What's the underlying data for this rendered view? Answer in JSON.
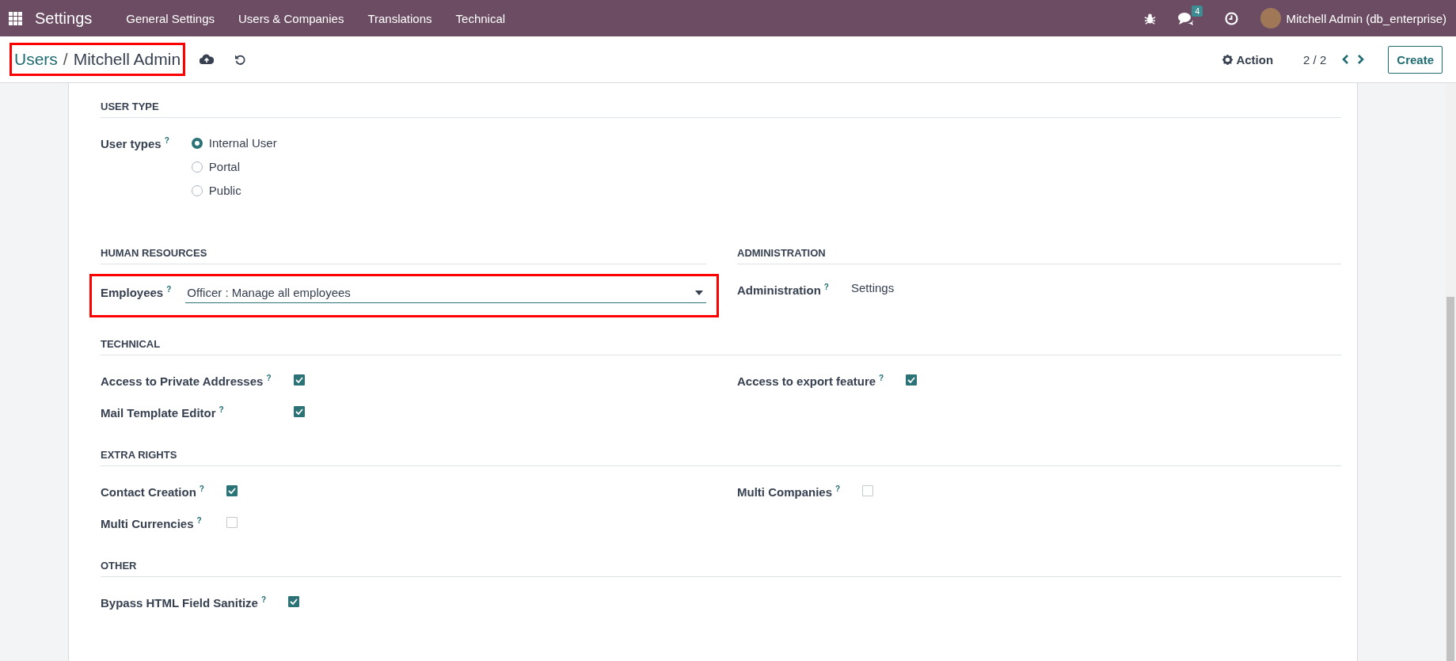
{
  "navbar": {
    "app_title": "Settings",
    "menu": [
      "General Settings",
      "Users & Companies",
      "Translations",
      "Technical"
    ],
    "messages_badge": "4",
    "user": "Mitchell Admin (db_enterprise)"
  },
  "control_panel": {
    "breadcrumb": [
      {
        "kind": "link",
        "text": "Users"
      },
      {
        "kind": "separator",
        "text": "/"
      },
      {
        "kind": "current",
        "text": "Mitchell Admin"
      }
    ],
    "highlighted": true,
    "action": "Action",
    "pager": "2 / 2",
    "create": "Create"
  },
  "blocks": [
    {
      "kind": "section",
      "title": "USER TYPE",
      "columns": [
        [
          {
            "kind": "radio",
            "label": "User types",
            "help": "?",
            "options": [
              {
                "label": "Internal User",
                "selected": true
              },
              {
                "label": "Portal",
                "selected": false
              },
              {
                "label": "Public",
                "selected": false
              }
            ]
          }
        ]
      ]
    },
    {
      "kind": "pair",
      "sections": [
        {
          "title": "HUMAN RESOURCES",
          "fields": [
            {
              "kind": "select",
              "label": "Employees",
              "help": "?",
              "value": "Officer : Manage all employees",
              "highlighted": true
            }
          ]
        },
        {
          "title": "ADMINISTRATION",
          "fields": [
            {
              "kind": "text",
              "label": "Administration",
              "help": "?",
              "value": "Settings"
            }
          ]
        }
      ]
    },
    {
      "kind": "section",
      "title": "TECHNICAL",
      "columns": [
        [
          {
            "kind": "checkbox",
            "label": "Access to Private Addresses",
            "help": "?",
            "checked": true
          },
          {
            "kind": "checkbox",
            "label": "Mail Template Editor",
            "help": "?",
            "checked": true
          }
        ],
        [
          {
            "kind": "checkbox",
            "label": "Access to export feature",
            "help": "?",
            "checked": true
          }
        ]
      ]
    },
    {
      "kind": "section",
      "title": "EXTRA RIGHTS",
      "columns": [
        [
          {
            "kind": "checkbox",
            "label": "Contact Creation",
            "help": "?",
            "checked": true
          },
          {
            "kind": "checkbox",
            "label": "Multi Currencies",
            "help": "?",
            "checked": false
          }
        ],
        [
          {
            "kind": "checkbox",
            "label": "Multi Companies",
            "help": "?",
            "checked": false
          }
        ]
      ]
    },
    {
      "kind": "section",
      "title": "OTHER",
      "columns": [
        [
          {
            "kind": "checkbox",
            "label": "Bypass HTML Field Sanitize",
            "help": "?",
            "checked": true
          }
        ]
      ]
    }
  ]
}
